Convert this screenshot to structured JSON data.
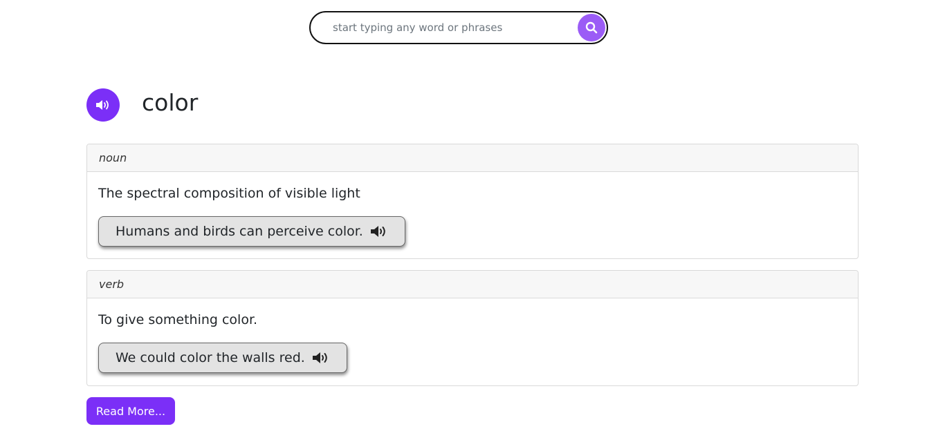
{
  "search": {
    "placeholder": "start typing any word or phrases",
    "value": "",
    "button_icon": "search-icon",
    "button_color": "#9b5cf6"
  },
  "word": {
    "text": "color",
    "speak_icon": "speaker-icon",
    "speak_color": "#7b2ff7"
  },
  "meanings": [
    {
      "part_of_speech": "noun",
      "definition": "The spectral composition of visible light",
      "example": "Humans and birds can perceive color.",
      "example_icon": "speaker-icon"
    },
    {
      "part_of_speech": "verb",
      "definition": "To give something color.",
      "example": "We could color the walls red.",
      "example_icon": "speaker-icon"
    }
  ],
  "read_more": {
    "label": "Read More...",
    "color": "#7b2ff7"
  }
}
